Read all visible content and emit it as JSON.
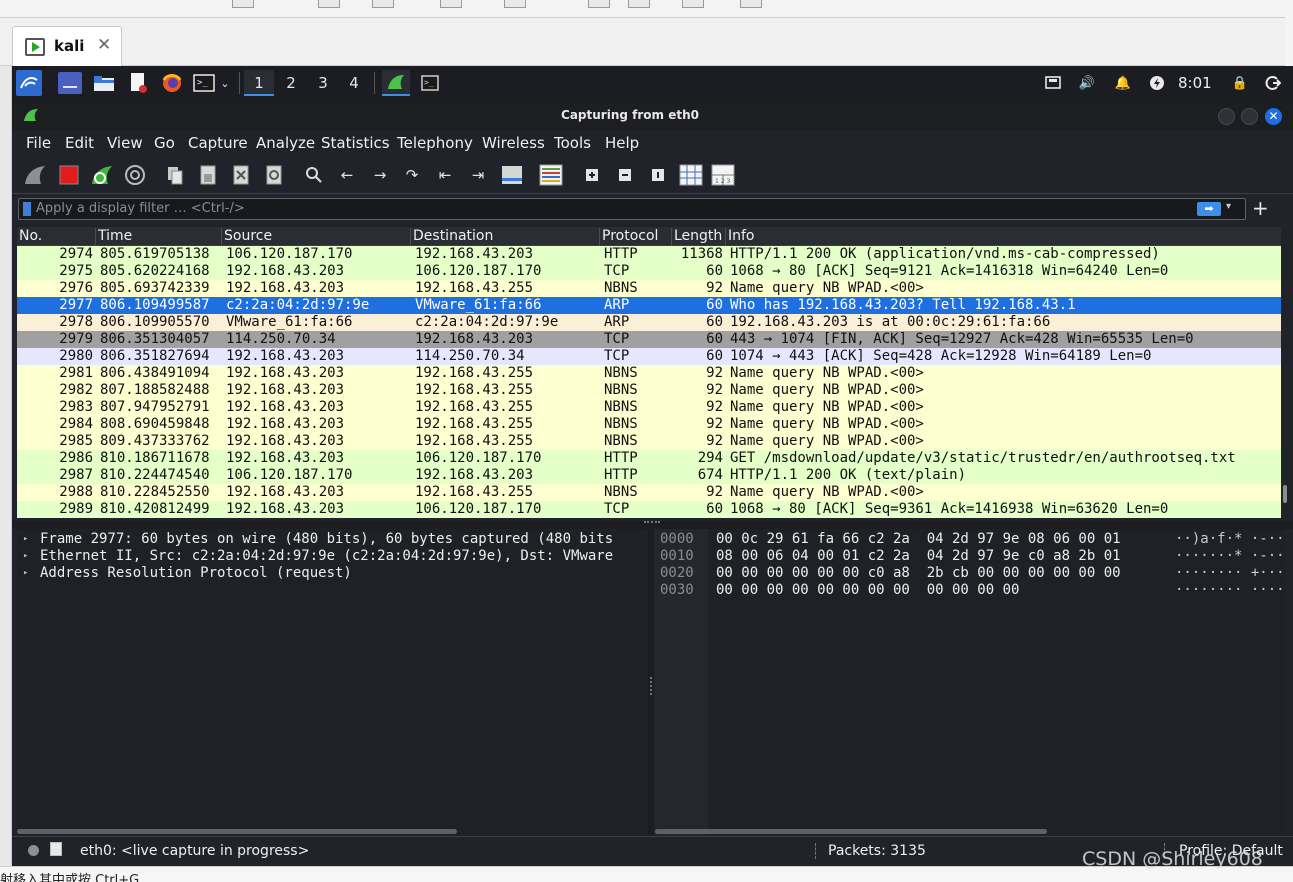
{
  "vm_tab": {
    "label": "kali"
  },
  "panel": {
    "workspaces": [
      "1",
      "2",
      "3",
      "4"
    ],
    "active_workspace": 0,
    "clock": "8:01"
  },
  "window": {
    "title": "Capturing from eth0"
  },
  "menu": [
    "File",
    "Edit",
    "View",
    "Go",
    "Capture",
    "Analyze",
    "Statistics",
    "Telephony",
    "Wireless",
    "Tools",
    "Help"
  ],
  "filter": {
    "placeholder": "Apply a display filter … <Ctrl-/>"
  },
  "columns": {
    "no": "No.",
    "time": "Time",
    "source": "Source",
    "destination": "Destination",
    "protocol": "Protocol",
    "length": "Length",
    "info": "Info"
  },
  "colors": {
    "http": "#e4ffc7",
    "tcp": "#e7e6ff",
    "nbns": "#feffd0",
    "arp": "#faf0d7",
    "selected": "#1e6fe0",
    "tcp_fin": "#a0a0a0"
  },
  "packets": [
    {
      "no": "2974",
      "time": "805.619705138",
      "src": "106.120.187.170",
      "dst": "192.168.43.203",
      "proto": "HTTP",
      "len": "11368",
      "info": "HTTP/1.1 200 OK  (application/vnd.ms-cab-compressed)",
      "color": "http"
    },
    {
      "no": "2975",
      "time": "805.620224168",
      "src": "192.168.43.203",
      "dst": "106.120.187.170",
      "proto": "TCP",
      "len": "60",
      "info": "1068 → 80 [ACK] Seq=9121 Ack=1416318 Win=64240 Len=0",
      "color": "http"
    },
    {
      "no": "2976",
      "time": "805.693742339",
      "src": "192.168.43.203",
      "dst": "192.168.43.255",
      "proto": "NBNS",
      "len": "92",
      "info": "Name query NB WPAD.<00>",
      "color": "nbns"
    },
    {
      "no": "2977",
      "time": "806.109499587",
      "src": "c2:2a:04:2d:97:9e",
      "dst": "VMware_61:fa:66",
      "proto": "ARP",
      "len": "60",
      "info": "Who has 192.168.43.203? Tell 192.168.43.1",
      "color": "selected"
    },
    {
      "no": "2978",
      "time": "806.109905570",
      "src": "VMware_61:fa:66",
      "dst": "c2:2a:04:2d:97:9e",
      "proto": "ARP",
      "len": "60",
      "info": "192.168.43.203 is at 00:0c:29:61:fa:66",
      "color": "arp"
    },
    {
      "no": "2979",
      "time": "806.351304057",
      "src": "114.250.70.34",
      "dst": "192.168.43.203",
      "proto": "TCP",
      "len": "60",
      "info": "443 → 1074 [FIN, ACK] Seq=12927 Ack=428 Win=65535 Len=0",
      "color": "tcp_fin"
    },
    {
      "no": "2980",
      "time": "806.351827694",
      "src": "192.168.43.203",
      "dst": "114.250.70.34",
      "proto": "TCP",
      "len": "60",
      "info": "1074 → 443 [ACK] Seq=428 Ack=12928 Win=64189 Len=0",
      "color": "tcp"
    },
    {
      "no": "2981",
      "time": "806.438491094",
      "src": "192.168.43.203",
      "dst": "192.168.43.255",
      "proto": "NBNS",
      "len": "92",
      "info": "Name query NB WPAD.<00>",
      "color": "nbns"
    },
    {
      "no": "2982",
      "time": "807.188582488",
      "src": "192.168.43.203",
      "dst": "192.168.43.255",
      "proto": "NBNS",
      "len": "92",
      "info": "Name query NB WPAD.<00>",
      "color": "nbns"
    },
    {
      "no": "2983",
      "time": "807.947952791",
      "src": "192.168.43.203",
      "dst": "192.168.43.255",
      "proto": "NBNS",
      "len": "92",
      "info": "Name query NB WPAD.<00>",
      "color": "nbns"
    },
    {
      "no": "2984",
      "time": "808.690459848",
      "src": "192.168.43.203",
      "dst": "192.168.43.255",
      "proto": "NBNS",
      "len": "92",
      "info": "Name query NB WPAD.<00>",
      "color": "nbns"
    },
    {
      "no": "2985",
      "time": "809.437333762",
      "src": "192.168.43.203",
      "dst": "192.168.43.255",
      "proto": "NBNS",
      "len": "92",
      "info": "Name query NB WPAD.<00>",
      "color": "nbns"
    },
    {
      "no": "2986",
      "time": "810.186711678",
      "src": "192.168.43.203",
      "dst": "106.120.187.170",
      "proto": "HTTP",
      "len": "294",
      "info": "GET /msdownload/update/v3/static/trustedr/en/authrootseq.txt",
      "color": "http"
    },
    {
      "no": "2987",
      "time": "810.224474540",
      "src": "106.120.187.170",
      "dst": "192.168.43.203",
      "proto": "HTTP",
      "len": "674",
      "info": "HTTP/1.1 200 OK  (text/plain)",
      "color": "http"
    },
    {
      "no": "2988",
      "time": "810.228452550",
      "src": "192.168.43.203",
      "dst": "192.168.43.255",
      "proto": "NBNS",
      "len": "92",
      "info": "Name query NB WPAD.<00>",
      "color": "nbns"
    },
    {
      "no": "2989",
      "time": "810.420812499",
      "src": "192.168.43.203",
      "dst": "106.120.187.170",
      "proto": "TCP",
      "len": "60",
      "info": "1068 → 80 [ACK] Seq=9361 Ack=1416938 Win=63620 Len=0",
      "color": "http"
    }
  ],
  "details": [
    "Frame 2977: 60 bytes on wire (480 bits), 60 bytes captured (480 bits",
    "Ethernet II, Src: c2:2a:04:2d:97:9e (c2:2a:04:2d:97:9e), Dst: VMware",
    "Address Resolution Protocol (request)"
  ],
  "bytes": [
    {
      "off": "0000",
      "hex": "00 0c 29 61 fa 66 c2 2a  04 2d 97 9e 08 06 00 01",
      "ascii": "··)a·f·* ·-······"
    },
    {
      "off": "0010",
      "hex": "08 00 06 04 00 01 c2 2a  04 2d 97 9e c0 a8 2b 01",
      "ascii": "·······* ·-····+·"
    },
    {
      "off": "0020",
      "hex": "00 00 00 00 00 00 c0 a8  2b cb 00 00 00 00 00 00",
      "ascii": "········ +·······"
    },
    {
      "off": "0030",
      "hex": "00 00 00 00 00 00 00 00  00 00 00 00",
      "ascii": "········ ····"
    }
  ],
  "status": {
    "capture": "eth0: <live capture in progress>",
    "packets": "Packets: 3135",
    "profile": "Profile: Default"
  },
  "host": {
    "bottom_text": "射移入其中或按 Ctrl+G"
  },
  "watermark": "CSDN @Shirley608"
}
